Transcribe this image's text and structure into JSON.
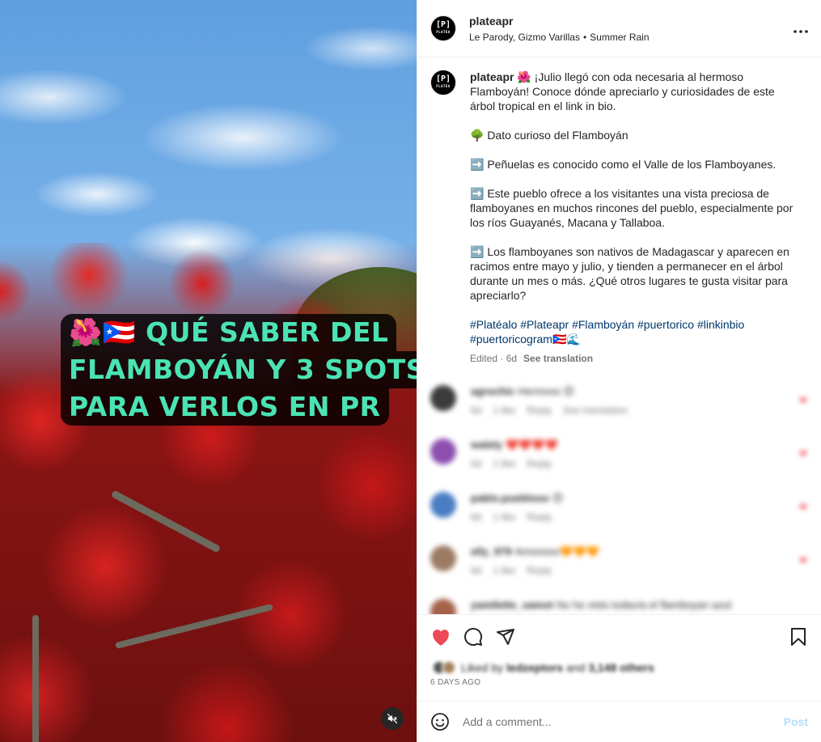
{
  "post": {
    "username": "plateapr",
    "audio": "Le Parody, Gizmo Varillas",
    "audio_track": "Summer Rain",
    "more_label": "•••",
    "avatar_text": "[P]",
    "avatar_sub": "PLATEA"
  },
  "media": {
    "overlay_lines": [
      "🌺🇵🇷 QUÉ SABER DEL",
      "FLAMBOYÁN Y 3 SPOTS",
      "PARA VERLOS EN PR"
    ],
    "mute_icon": "speaker-muted-icon"
  },
  "caption": {
    "username": "plateapr",
    "intro": "🌺 ¡Julio llegó con oda necesaria al hermoso Flamboyán! Conoce dónde apreciarlo y curiosidades de este árbol tropical en el link in bio.",
    "heading": "🌳 Dato curioso del Flamboyán",
    "fact1": "➡️ Peñuelas es conocido como el Valle de los Flamboyanes.",
    "fact2": "➡️ Este pueblo ofrece a los visitantes una vista preciosa de flamboyanes en muchos rincones del pueblo, especialmente por los ríos Guayanés, Macana y Tallaboa.",
    "fact3": "➡️ Los flamboyanes son nativos de Madagascar y aparecen en racimos entre mayo y julio, y tienden a permanecer en el árbol durante un mes o más. ¿Qué otros lugares te gusta visitar para apreciarlo?",
    "hashtags": "#Platéalo #Plateapr #Flamboyán #puertorico #linkinbio #puertoricogram🇵🇷🌊",
    "edited": "Edited · 6d",
    "see_translation": "See translation"
  },
  "comments": [
    {
      "user": "agrochic",
      "text": "Hermoso 😊",
      "time": "6d",
      "likes": "1 like",
      "reply": "Reply",
      "translation": "See translation",
      "avatar_color": "#3b3b3b"
    },
    {
      "user": "walely",
      "text": "❤️❤️❤️❤️",
      "time": "5d",
      "likes": "1 like",
      "reply": "Reply",
      "translation": "",
      "avatar_color": "#8c4fb0"
    },
    {
      "user": "pablo.pueblooo",
      "text": "😊",
      "time": "6d",
      "likes": "1 like",
      "reply": "Reply",
      "translation": "",
      "avatar_color": "#4a7dc4"
    },
    {
      "user": "elly_979",
      "text": "Amooooo🧡🧡🧡",
      "time": "6d",
      "likes": "1 like",
      "reply": "Reply",
      "translation": "",
      "avatar_color": "#9c7b63"
    },
    {
      "user": "yamilette_samot",
      "text": "No he visto todavía el flamboyan azul",
      "time": "",
      "likes": "",
      "reply": "",
      "translation": "",
      "avatar_color": "#a5624b"
    }
  ],
  "actions": {
    "like_icon": "heart-filled-icon",
    "comment_icon": "comment-icon",
    "share_icon": "share-icon",
    "save_icon": "bookmark-icon",
    "liked_by_prefix": "Liked by",
    "liked_by_user": "ledzeptors",
    "liked_by_and": "and",
    "liked_by_others": "3,148 others",
    "date": "6 DAYS AGO"
  },
  "add_comment": {
    "placeholder": "Add a comment...",
    "post_label": "Post",
    "emoji_icon": "smiley-icon"
  },
  "colors": {
    "heart": "#ed4956",
    "overlay_text": "#4be3b4",
    "hashtag": "#00376b",
    "post_disabled": "#b2dffc"
  }
}
